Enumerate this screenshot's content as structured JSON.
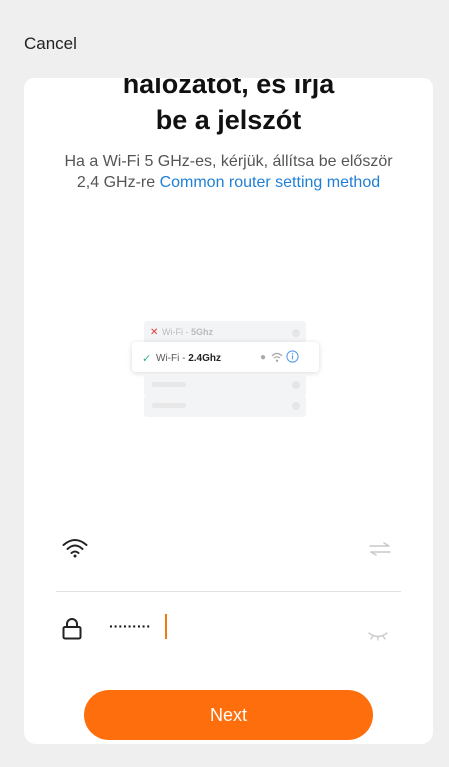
{
  "header": {
    "cancel_label": "Cancel"
  },
  "title": {
    "line1": "hálózatot, és írja",
    "line2": "be a jelszót"
  },
  "description": {
    "text": "Ha a Wi-Fi 5 GHz-es, kérjük, állítsa be először 2,4 GHz-re ",
    "link": "Common router setting method"
  },
  "illustration": {
    "row_5ghz_prefix": "Wi-Fi - ",
    "row_5ghz_band": "5Ghz",
    "row_24_prefix": "Wi-Fi - ",
    "row_24_band": "2.4Ghz"
  },
  "form": {
    "wifi_value": "",
    "password_value": "·········"
  },
  "next_label": "Next",
  "colors": {
    "accent": "#ff6e0c",
    "link": "#1f7fd6",
    "error": "#e53935",
    "success": "#36b37e"
  }
}
